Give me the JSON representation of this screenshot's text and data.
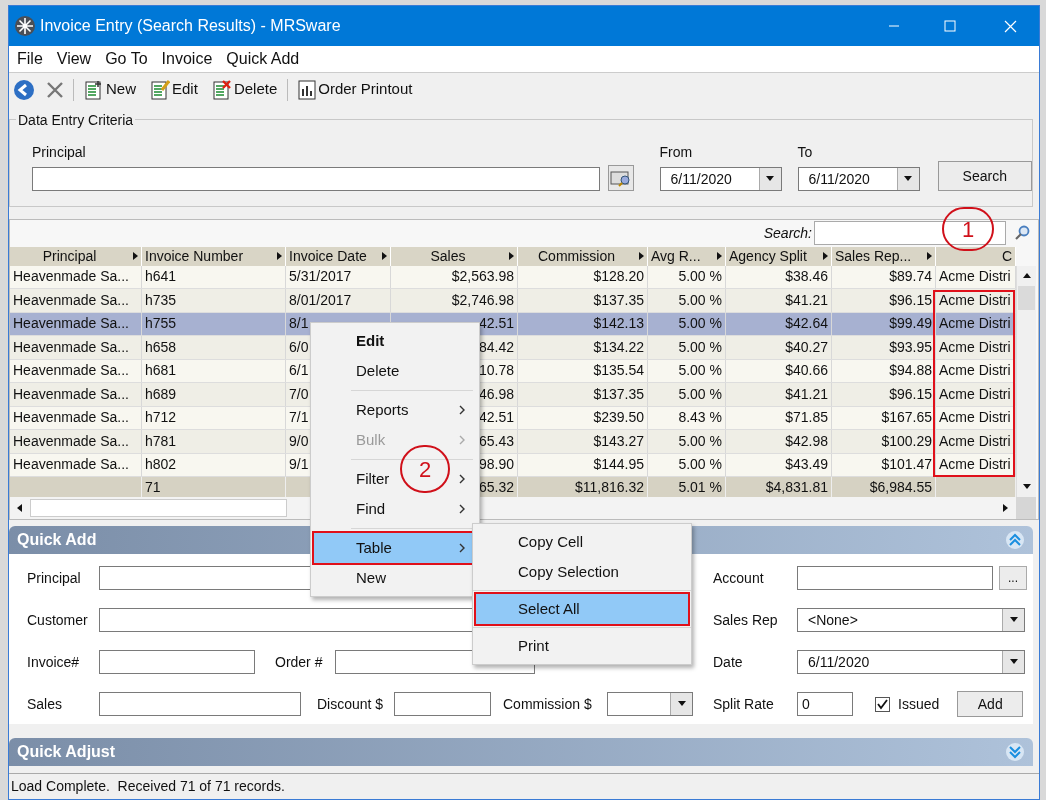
{
  "window": {
    "title": "Invoice Entry (Search Results) - MRSware"
  },
  "menu_bar": [
    "File",
    "View",
    "Go To",
    "Invoice",
    "Quick Add"
  ],
  "toolbar": [
    {
      "kind": "back"
    },
    {
      "kind": "cancel"
    },
    {
      "kind": "new",
      "label": "New"
    },
    {
      "kind": "edit",
      "label": "Edit"
    },
    {
      "kind": "delete",
      "label": "Delete"
    },
    {
      "kind": "printout",
      "label": "Order Printout"
    }
  ],
  "criteria": {
    "title": "Data Entry Criteria",
    "principal_label": "Principal",
    "from_label": "From",
    "from_value": "6/11/2020",
    "to_label": "To",
    "to_value": "6/11/2020",
    "search_button": "Search"
  },
  "grid": {
    "search_label": "Search:",
    "columns": [
      {
        "label": "Principal",
        "kind": "text",
        "filter": true,
        "marked": false
      },
      {
        "label": "Invoice Number",
        "kind": "text",
        "filter": true,
        "marked": false
      },
      {
        "label": "Invoice Date",
        "kind": "text",
        "filter": true,
        "marked": false
      },
      {
        "label": "Sales",
        "kind": "number",
        "filter": true,
        "marked": false
      },
      {
        "label": "Commission",
        "kind": "number",
        "filter": true,
        "marked": false
      },
      {
        "label": "Avg R...",
        "kind": "number",
        "filter": true,
        "marked": false
      },
      {
        "label": "Agency Split",
        "kind": "number",
        "filter": true,
        "marked": false
      },
      {
        "label": "Sales Rep...",
        "kind": "number",
        "filter": true,
        "marked": false
      },
      {
        "label": "C",
        "kind": "text",
        "filter": false,
        "marked": true
      }
    ],
    "rows": [
      {
        "selected": false,
        "cells": [
          "Heavenmade Sa...",
          "h641",
          "5/31/2017",
          "$2,563.98",
          "$128.20",
          "5.00 %",
          "$38.46",
          "$89.74",
          "Acme Distri"
        ]
      },
      {
        "selected": false,
        "cells": [
          "Heavenmade Sa...",
          "h735",
          "8/01/2017",
          "$2,746.98",
          "$137.35",
          "5.00 %",
          "$41.21",
          "$96.15",
          "Acme Distri"
        ]
      },
      {
        "selected": true,
        "cells": [
          "Heavenmade Sa...",
          "h755",
          "8/1",
          "42.51",
          "$142.13",
          "5.00 %",
          "$42.64",
          "$99.49",
          "Acme Distri"
        ]
      },
      {
        "selected": false,
        "cells": [
          "Heavenmade Sa...",
          "h658",
          "6/0",
          "84.42",
          "$134.22",
          "5.00 %",
          "$40.27",
          "$93.95",
          "Acme Distri"
        ]
      },
      {
        "selected": false,
        "cells": [
          "Heavenmade Sa...",
          "h681",
          "6/1",
          "10.78",
          "$135.54",
          "5.00 %",
          "$40.66",
          "$94.88",
          "Acme Distri"
        ]
      },
      {
        "selected": false,
        "cells": [
          "Heavenmade Sa...",
          "h689",
          "7/0",
          "46.98",
          "$137.35",
          "5.00 %",
          "$41.21",
          "$96.15",
          "Acme Distri"
        ]
      },
      {
        "selected": false,
        "cells": [
          "Heavenmade Sa...",
          "h712",
          "7/1",
          "42.51",
          "$239.50",
          "8.43 %",
          "$71.85",
          "$167.65",
          "Acme Distri"
        ]
      },
      {
        "selected": false,
        "cells": [
          "Heavenmade Sa...",
          "h781",
          "9/0",
          "65.43",
          "$143.27",
          "5.00 %",
          "$42.98",
          "$100.29",
          "Acme Distri"
        ]
      },
      {
        "selected": false,
        "cells": [
          "Heavenmade Sa...",
          "h802",
          "9/1",
          "98.90",
          "$144.95",
          "5.00 %",
          "$43.49",
          "$101.47",
          "Acme Distri"
        ]
      }
    ],
    "totals": {
      "count": "71",
      "sales": "65.32",
      "commission": "$11,816.32",
      "avg_rate": "5.01 %",
      "agency_split": "$4,831.81",
      "sales_rep": "$6,984.55"
    }
  },
  "context_menu": [
    {
      "kind": "item",
      "label": "Edit",
      "bold": true,
      "disabled": false,
      "submenu": false,
      "highlighted": false,
      "marked": false
    },
    {
      "kind": "item",
      "label": "Delete",
      "bold": false,
      "disabled": false,
      "submenu": false,
      "highlighted": false,
      "marked": false
    },
    {
      "kind": "separator"
    },
    {
      "kind": "item",
      "label": "Reports",
      "bold": false,
      "disabled": false,
      "submenu": true,
      "highlighted": false,
      "marked": false
    },
    {
      "kind": "item",
      "label": "Bulk",
      "bold": false,
      "disabled": true,
      "submenu": true,
      "highlighted": false,
      "marked": false
    },
    {
      "kind": "separator"
    },
    {
      "kind": "item",
      "label": "Filter",
      "bold": false,
      "disabled": false,
      "submenu": true,
      "highlighted": false,
      "marked": false
    },
    {
      "kind": "item",
      "label": "Find",
      "bold": false,
      "disabled": false,
      "submenu": true,
      "highlighted": false,
      "marked": false
    },
    {
      "kind": "separator"
    },
    {
      "kind": "item",
      "label": "Table",
      "bold": false,
      "disabled": false,
      "submenu": true,
      "highlighted": true,
      "marked": true
    },
    {
      "kind": "item",
      "label": "New",
      "bold": false,
      "disabled": false,
      "submenu": false,
      "highlighted": false,
      "marked": false
    }
  ],
  "submenu": [
    {
      "kind": "item",
      "label": "Copy Cell",
      "highlighted": false,
      "marked": false
    },
    {
      "kind": "item",
      "label": "Copy Selection",
      "highlighted": false,
      "marked": false
    },
    {
      "kind": "separator"
    },
    {
      "kind": "item",
      "label": "Select All",
      "highlighted": true,
      "marked": true
    },
    {
      "kind": "separator"
    },
    {
      "kind": "item",
      "label": "Print",
      "highlighted": false,
      "marked": false
    }
  ],
  "quick_add": {
    "title": "Quick Add",
    "expanded": true,
    "principal_label": "Principal",
    "customer_label": "Customer",
    "invoice_label": "Invoice#",
    "order_label": "Order #",
    "sales_label": "Sales",
    "discount_label": "Discount $",
    "commission_label": "Commission $",
    "account_label": "Account",
    "account_button": "...",
    "sales_rep_label": "Sales Rep",
    "sales_rep_value": "<None>",
    "date_label": "Date",
    "date_value": "6/11/2020",
    "split_rate_label": "Split Rate",
    "split_rate_value": "0",
    "issued_label": "Issued",
    "issued_checked": true,
    "add_button": "Add"
  },
  "quick_adjust": {
    "title": "Quick Adjust",
    "expanded": false
  },
  "status_bar": "Load Complete.  Received 71 of 71 records.",
  "annotations": [
    {
      "label": "1"
    },
    {
      "label": "2"
    }
  ]
}
